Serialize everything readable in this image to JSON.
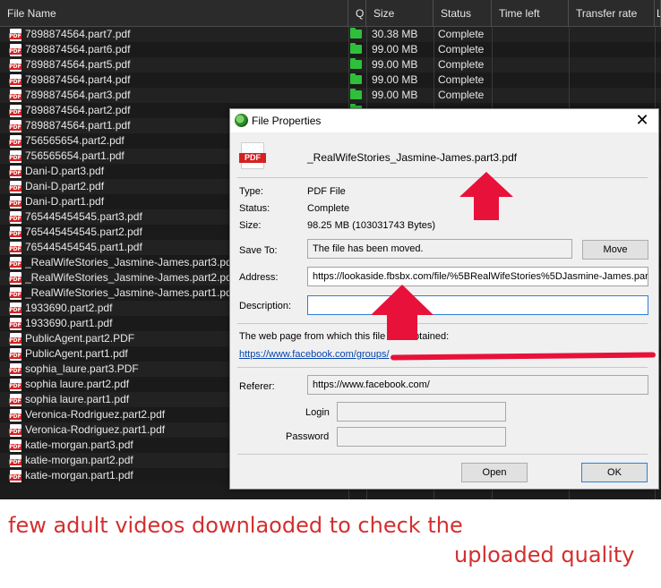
{
  "file_list": {
    "columns": [
      "File Name",
      "Q",
      "Size",
      "Status",
      "Time left",
      "Transfer rate",
      "L"
    ],
    "rows": [
      {
        "name": "7898874564.part7.pdf",
        "size": "30.38  MB",
        "status": "Complete"
      },
      {
        "name": "7898874564.part6.pdf",
        "size": "99.00  MB",
        "status": "Complete"
      },
      {
        "name": "7898874564.part5.pdf",
        "size": "99.00  MB",
        "status": "Complete"
      },
      {
        "name": "7898874564.part4.pdf",
        "size": "99.00  MB",
        "status": "Complete"
      },
      {
        "name": "7898874564.part3.pdf",
        "size": "99.00  MB",
        "status": "Complete"
      },
      {
        "name": "7898874564.part2.pdf",
        "size": "",
        "status": ""
      },
      {
        "name": "7898874564.part1.pdf",
        "size": "",
        "status": ""
      },
      {
        "name": "756565654.part2.pdf",
        "size": "",
        "status": ""
      },
      {
        "name": "756565654.part1.pdf",
        "size": "",
        "status": ""
      },
      {
        "name": "Dani-D.part3.pdf",
        "size": "",
        "status": ""
      },
      {
        "name": "Dani-D.part2.pdf",
        "size": "",
        "status": ""
      },
      {
        "name": "Dani-D.part1.pdf",
        "size": "",
        "status": ""
      },
      {
        "name": "765445454545.part3.pdf",
        "size": "",
        "status": ""
      },
      {
        "name": "765445454545.part2.pdf",
        "size": "",
        "status": ""
      },
      {
        "name": "765445454545.part1.pdf",
        "size": "",
        "status": ""
      },
      {
        "name": "_RealWifeStories_Jasmine-James.part3.pdf",
        "size": "",
        "status": ""
      },
      {
        "name": "_RealWifeStories_Jasmine-James.part2.pdf",
        "size": "",
        "status": ""
      },
      {
        "name": "_RealWifeStories_Jasmine-James.part1.pdf",
        "size": "",
        "status": ""
      },
      {
        "name": "1933690.part2.pdf",
        "size": "",
        "status": ""
      },
      {
        "name": "1933690.part1.pdf",
        "size": "",
        "status": ""
      },
      {
        "name": "PublicAgent.part2.PDF",
        "size": "",
        "status": ""
      },
      {
        "name": "PublicAgent.part1.pdf",
        "size": "",
        "status": ""
      },
      {
        "name": "sophia_laure.part3.PDF",
        "size": "",
        "status": ""
      },
      {
        "name": "sophia laure.part2.pdf",
        "size": "",
        "status": ""
      },
      {
        "name": "sophia laure.part1.pdf",
        "size": "",
        "status": ""
      },
      {
        "name": "Veronica-Rodriguez.part2.pdf",
        "size": "",
        "status": ""
      },
      {
        "name": "Veronica-Rodriguez.part1.pdf",
        "size": "",
        "status": ""
      },
      {
        "name": "katie-morgan.part3.pdf",
        "size": "",
        "status": ""
      },
      {
        "name": "katie-morgan.part2.pdf",
        "size": "",
        "status": ""
      },
      {
        "name": "katie-morgan.part1.pdf",
        "size": "",
        "status": ""
      }
    ]
  },
  "dialog": {
    "title": "File Properties",
    "close_glyph": "✕",
    "file_name": "_RealWifeStories_Jasmine-James.part3.pdf",
    "type_label": "Type:",
    "type_value": "PDF File",
    "status_label": "Status:",
    "status_value": "Complete",
    "size_label": "Size:",
    "size_value": "98.25  MB  (103031743 Bytes)",
    "save_to_label": "Save To:",
    "save_to_value": "The file has been moved.",
    "move_button": "Move",
    "address_label": "Address:",
    "address_value": "https://lookaside.fbsbx.com/file/%5BRealWifeStories%5DJasmine-James.par",
    "description_label": "Description:",
    "description_value": "",
    "webpage_label": "The web page from which this file was obtained:",
    "webpage_link": "https://www.facebook.com/groups/",
    "referer_label": "Referer:",
    "referer_value": "https://www.facebook.com/",
    "login_label": "Login",
    "login_value": "",
    "password_label": "Password",
    "password_value": "",
    "open_button": "Open",
    "ok_button": "OK"
  },
  "caption": {
    "line1": "few adult videos downlaoded to check the",
    "line2": "uploaded quality"
  },
  "colors": {
    "annotation_red": "#e8113a",
    "caption_red": "#d32f2f",
    "list_background": "#1c1c1c",
    "queue_icon_green": "#2fbf3a"
  }
}
